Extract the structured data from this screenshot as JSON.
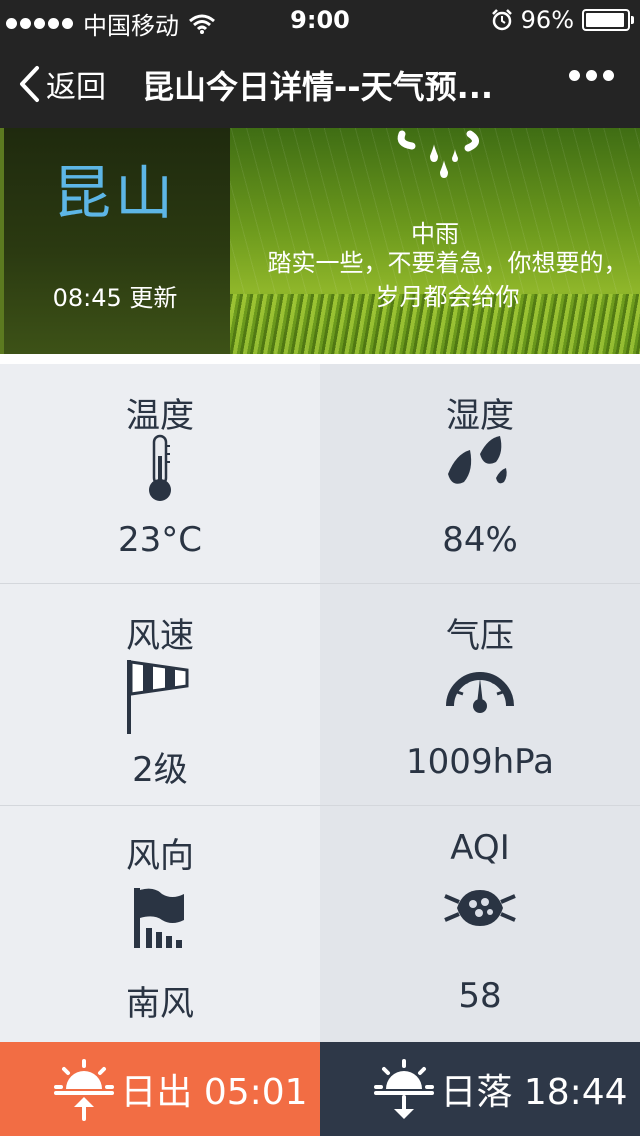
{
  "status_bar": {
    "carrier": "中国移动",
    "time": "9:00",
    "battery": "96%",
    "battery_level": 0.96
  },
  "nav": {
    "back_label": "返回",
    "title": "昆山今日详情--天气预..."
  },
  "hero": {
    "city": "昆山",
    "update_time": "08:45 更新",
    "condition": "中雨",
    "slogan": "踏实一些，不要着急，你想要的，岁月都会给你",
    "weather_icon": "rain-cloud-icon"
  },
  "metrics": {
    "temperature": {
      "label": "温度",
      "value": "23°C",
      "icon": "thermometer-icon"
    },
    "humidity": {
      "label": "湿度",
      "value": "84%",
      "icon": "water-drops-icon"
    },
    "wind_speed": {
      "label": "风速",
      "value": "2级",
      "icon": "windsock-icon"
    },
    "pressure": {
      "label": "气压",
      "value": "1009hPa",
      "icon": "gauge-icon"
    },
    "wind_direction": {
      "label": "风向",
      "value": "南风",
      "icon": "wind-flag-icon"
    },
    "aqi": {
      "label": "AQI",
      "value": "58",
      "icon": "mask-icon"
    }
  },
  "sun": {
    "sunrise_label": "日出 05:01",
    "sunset_label": "日落 18:44"
  },
  "colors": {
    "city": "#5db6e6",
    "sunrise_bg": "#f26d44",
    "sunset_bg": "#2e3848",
    "text_dark": "#2a3443"
  }
}
